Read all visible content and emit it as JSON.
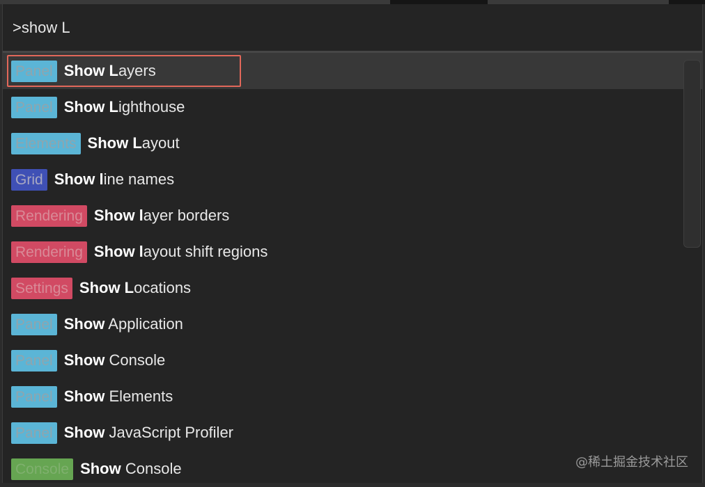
{
  "prompt": {
    "value": ">show L"
  },
  "items": [
    {
      "tag": "Panel",
      "tag_kind": "panel",
      "bold": "Show L",
      "rest": "ayers",
      "selected": true
    },
    {
      "tag": "Panel",
      "tag_kind": "panel",
      "bold": "Show L",
      "rest": "ighthouse"
    },
    {
      "tag": "Elements",
      "tag_kind": "elements",
      "bold": "Show L",
      "rest": "ayout"
    },
    {
      "tag": "Grid",
      "tag_kind": "grid",
      "bold": "Show l",
      "rest": "ine names"
    },
    {
      "tag": "Rendering",
      "tag_kind": "rendering",
      "bold": "Show l",
      "rest": "ayer borders"
    },
    {
      "tag": "Rendering",
      "tag_kind": "rendering",
      "bold": "Show l",
      "rest": "ayout shift regions"
    },
    {
      "tag": "Settings",
      "tag_kind": "settings",
      "bold": "Show L",
      "rest": "ocations"
    },
    {
      "tag": "Panel",
      "tag_kind": "panel",
      "bold": "Show",
      "rest": " Application"
    },
    {
      "tag": "Panel",
      "tag_kind": "panel",
      "bold": "Show",
      "rest": " Console"
    },
    {
      "tag": "Panel",
      "tag_kind": "panel",
      "bold": "Show",
      "rest": " Elements"
    },
    {
      "tag": "Panel",
      "tag_kind": "panel",
      "bold": "Show",
      "rest": " JavaScript Profiler"
    },
    {
      "tag": "Console",
      "tag_kind": "console",
      "bold": "Show",
      "rest": " Console"
    }
  ],
  "watermark": "@稀土掘金技术社区",
  "colors": {
    "selection_outline": "#e2685a",
    "panel_tag": "#5bb5d6",
    "grid_tag": "#3f50b5",
    "rendering_tag": "#d14a63",
    "console_tag": "#66a552"
  }
}
